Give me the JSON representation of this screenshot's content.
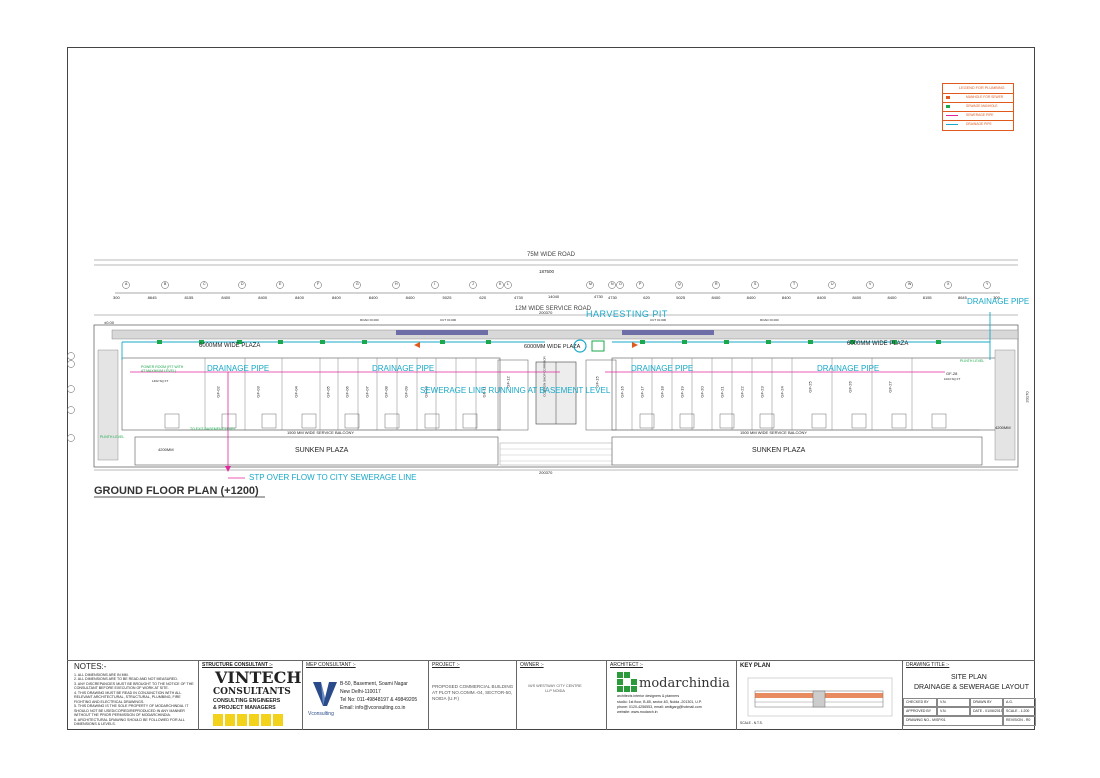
{
  "roads": {
    "top_road": "75M WIDE ROAD",
    "service_road": "12M WIDE SERVICE ROAD"
  },
  "dimensions": {
    "overall_top": "187500",
    "overall_plot": "200370",
    "overall_bottom": "200370",
    "center_a": "14040",
    "center_b": "4730",
    "side_right": "20170",
    "segments_left": [
      "300",
      "8645",
      "8155",
      "8400",
      "8400",
      "8400",
      "8400",
      "8400",
      "8400",
      "5025",
      "620",
      "4730"
    ],
    "segments_right": [
      "4730",
      "620",
      "5025",
      "8400",
      "8400",
      "8400",
      "8400",
      "8400",
      "8400",
      "8155",
      "8645",
      "300"
    ]
  },
  "grid_axes": [
    "A",
    "B",
    "C",
    "D",
    "E",
    "F",
    "G",
    "H",
    "I",
    "J",
    "K",
    "L",
    "M",
    "N",
    "O",
    "P",
    "Q",
    "R",
    "S",
    "T",
    "U",
    "V",
    "W",
    "X",
    "Y",
    "Z"
  ],
  "plan": {
    "wide_plaza_left": "6000MM WIDE PLAZA",
    "wide_plaza_center": "6000MM WIDE PLAZA",
    "wide_plaza_right": "6000MM WIDE PLAZA",
    "balcony_left": "1500 MM WIDE SERVICE BALCONY",
    "balcony_right": "1500 MM WIDE SERVICE BALCONY",
    "sunken_left": "SUNKEN PLAZA",
    "sunken_right": "SUNKEN PLAZA",
    "dim_4200_left": "4200MM",
    "dim_4200_right": "4200MM",
    "shops_left": [
      "GF-02",
      "GF-03",
      "GF-04",
      "GF-05",
      "GF-06",
      "GF-07",
      "GF-08",
      "GF-09",
      "GF-10",
      "GF-11",
      "GF-12"
    ],
    "shops_right": [
      "GF-15",
      "GF-16",
      "GF-17",
      "GF-18",
      "GF-19",
      "GF-20",
      "GF-21",
      "GF-22",
      "GF-23",
      "GF-24",
      "GF-25",
      "GF-26",
      "GF-27"
    ],
    "shop_area": "1102 SQ FT",
    "gf28": "GF-28",
    "gf28_area": "1024 SQ FT",
    "gf01_area": "1402 SQ FT",
    "power_room_note": "POWER ROOM (FIT WITH AT MAXIMUM LEVEL)",
    "basement_note": "TO EXIT BASEMENT LEVEL",
    "rising_left": "PLINTH LEVEL",
    "rising_right": "PLINTH LEVEL",
    "ground_level": "±0.00",
    "road_level_left": "ROAD ±0.000",
    "road_level_right": "ROAD ±0.000",
    "cut_level_left": "CUT ±0.000",
    "cut_level_right": "CUT ±0.000",
    "corridor_label": "COMMON SHOP CORRIDOR"
  },
  "callouts": {
    "harvesting_pit": "HARVESTING PIT",
    "drainage_pipe_1": "DRAINAGE PIPE",
    "drainage_pipe_2": "DRAINAGE PIPE",
    "drainage_pipe_3": "DRAINAGE PIPE",
    "drainage_pipe_4": "DRAINAGE PIPE",
    "drainage_pipe_5": "DRAINAGE PIPE",
    "sewerage_line": "SEWERAGE LINE RUNNING AT BASEMENT LEVEL",
    "stp_overflow": "STP OVER FLOW TO CITY SEWERAGE LINE"
  },
  "plan_title": "GROUND FLOOR PLAN (+1200)",
  "legend": {
    "title": "LEGEND FOR PLUMBING",
    "items": [
      {
        "label": "MANHOLE FOR SEWER",
        "color": "#e05a1e"
      },
      {
        "label": "SEWAGE MANHOLE",
        "color": "#1aa84a"
      },
      {
        "label": "SEWERAGE PIPE",
        "color": "#e0289a"
      },
      {
        "label": "DRAINAGE PIPE",
        "color": "#18a9c8"
      }
    ]
  },
  "notes": {
    "title": "NOTES:-",
    "items": [
      "1. ALL DIMENSIONS ARE IN MM.",
      "2. ALL DIMENSIONS ARE TO BE READ AND NOT MEASURED.",
      "3. ANY DISCREPANCIES MUST BE BROUGHT TO THE NOTICE OF THE CONSULTANT BEFORE EXECUTION OF WORK AT SITE.",
      "4. THIS DRAWING MUST BE READ IN CONJUNCTION WITH ALL RELEVANT ARCHITECTURAL, STRUCTURAL, PLUMBING, FIRE FIGHTING AND ELECTRICAL DRAWINGS.",
      "5. THIS DRAWING IS THE SOLE PROPERTY OF MODARCHINDIA. IT SHOULD NOT BE USED/COPIED/REPRODUCED IN ANY MANNER WITHOUT THE PRIOR PERMISSION OF MODARCHINDIA.",
      "6. ARCHITECTURAL DRAWING SHOULD BE FOLLOWED FOR ALL DIMENSIONS & LEVELS."
    ]
  },
  "structure_consultant": {
    "header": "STRUCTURE CONSULTANT :-",
    "logo_main": "VINTECH",
    "logo_sub1": "CONSULTANTS",
    "logo_sub2": "CONSULTING ENGINEERS",
    "logo_sub3": "& PROJECT MANAGERS"
  },
  "mep_consultant": {
    "header": "MEP CONSULTANT :-",
    "logo_text": "Vconsulting",
    "address1": "B-50, Basement, Soami Nagar",
    "address2": "New Delhi-110017",
    "phone": "Tel No: 011-49848197 & 49849205",
    "email": "Email: info@vconsulting.co.in"
  },
  "project": {
    "header": "PROJECT :-",
    "text": "PROPOSED COMMERCIAL BUILDING AT PLOT NO.COMM.-04, SECTOR-50, NOIDA (U.P.)"
  },
  "owner": {
    "header": "OWNER :-",
    "text": "M/S WESTWAY CITY CENTRE LLP NOIDA"
  },
  "architect": {
    "header": "ARCHITECT :-",
    "name": "modarchindia",
    "sub": "architects interior designers & planners",
    "addr1": "studio: 1st floor, B-85, sector-63, Noida -201301, U.P.",
    "addr2": "phone: 0120-4256553, email: amitgarg@hotmail.com",
    "addr3": "website: www.modarch.in"
  },
  "key_plan": {
    "header": "KEY PLAN",
    "scale": "SCALE - N.T.S."
  },
  "drawing": {
    "header": "DRAWING TITLE :-",
    "title1": "SITE PLAN",
    "title2": "DRAINAGE & SEWERAGE LAYOUT",
    "checked_label": "CHECKED BY",
    "checked_val": "V.N.",
    "drawn_label": "DRAWN BY",
    "drawn_val": "A.G.",
    "approved_label": "APPROVED BY",
    "approved_val": "V.N.",
    "date_label": "DATE - 01/06/2015",
    "scale_label": "SCALE - 1:200",
    "number_label": "DRAWING NO.- M/SP/01",
    "revision_label": "REVISION - R0"
  },
  "colors": {
    "drainage": "#18a9c8",
    "sewer": "#e0289a",
    "manhole": "#1aa84a",
    "legend_border": "#e05a1e"
  }
}
